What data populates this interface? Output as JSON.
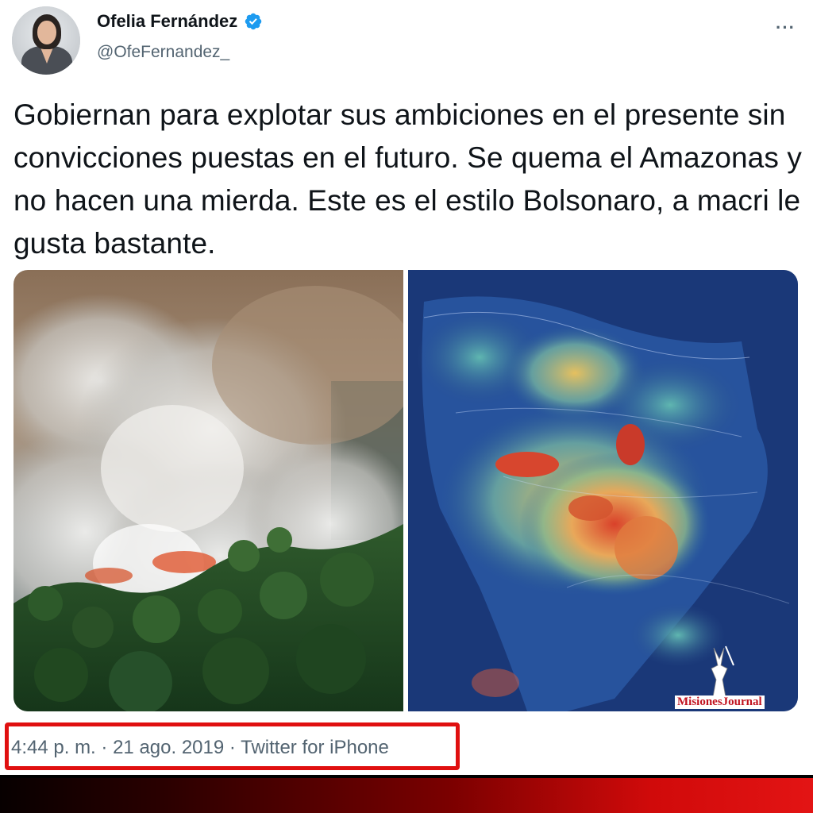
{
  "author": {
    "display_name": "Ofelia Fernández",
    "handle": "@OfeFernandez_",
    "verified": true
  },
  "tweet": {
    "text": "Gobiernan para explotar sus ambiciones en el presente sin convicciones puestas en el futuro. Se quema el Amazonas y no hacen una mierda. Este es el estilo Bolsonaro, a macri le gusta bastante."
  },
  "media": {
    "left_image": "amazon-fire-smoke-photo",
    "right_image": "south-america-heat-map"
  },
  "meta": {
    "time": "4:44 p. m.",
    "separator": "·",
    "date": "21 ago. 2019",
    "source": "Twitter for iPhone"
  },
  "watermark": {
    "text": "MisionesJournal"
  },
  "more_label": "···",
  "colors": {
    "verified_blue": "#1d9bf0",
    "highlight_red": "#e01010",
    "secondary_text": "#536471"
  }
}
